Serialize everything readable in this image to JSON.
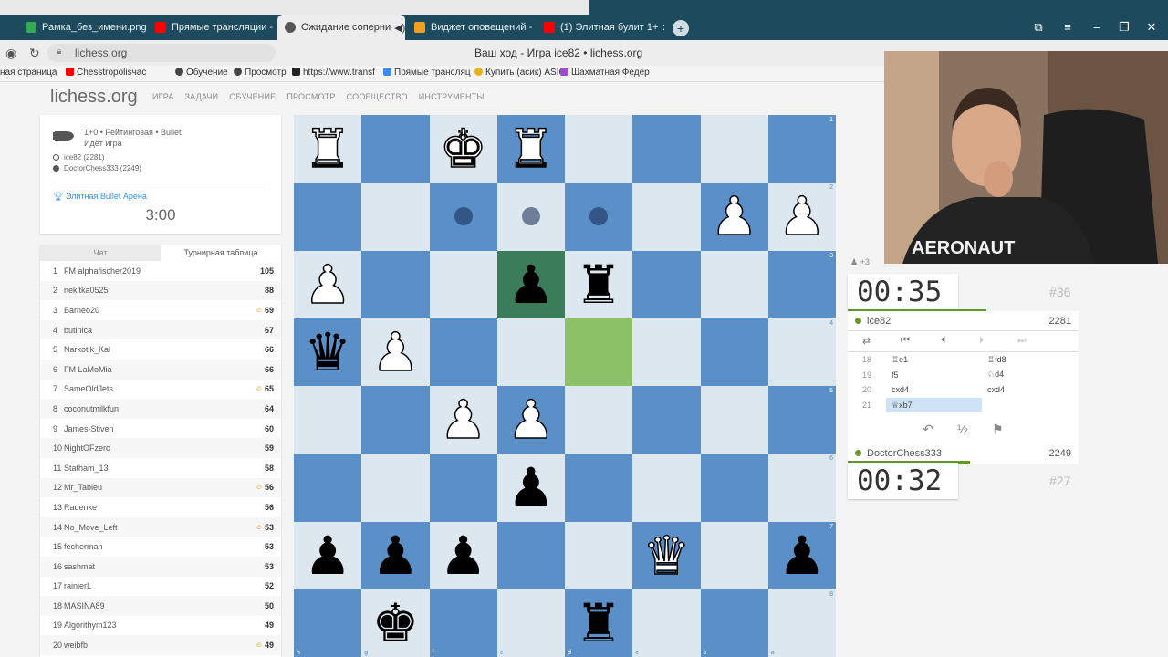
{
  "browser": {
    "tabs": [
      {
        "label": "Рамка_без_имени.png - G",
        "icon_color": "#34a853"
      },
      {
        "label": "Прямые трансляции - You",
        "icon_color": "#ff0000"
      },
      {
        "label": "Ожидание соперни",
        "icon_color": "#555555",
        "active": true
      },
      {
        "label": "Виджет оповещений - Па",
        "icon_color": "#f0a020"
      },
      {
        "label": "(1) Элитная булит 1+",
        "icon_color": "#ff0000"
      }
    ],
    "url": "lichess.org",
    "page_title": "Ваш ход - Игра ice82 • lichess.org",
    "bookmarks": [
      {
        "label": "ная страница",
        "icon_color": "#cccccc"
      },
      {
        "label": "Chesstropolisчас",
        "icon_color": "#ff0000"
      },
      {
        "label": "Обучение",
        "icon_color": "#444444"
      },
      {
        "label": "Просмотр",
        "icon_color": "#444444"
      },
      {
        "label": "https://www.transf",
        "icon_color": "#222222"
      },
      {
        "label": "Прямые трансляц",
        "icon_color": "#4285f4"
      },
      {
        "label": "Купить (асик) ASIC",
        "icon_color": "#e8b020"
      },
      {
        "label": "Шахматная Федер",
        "icon_color": "#9b4dca"
      }
    ]
  },
  "site": {
    "logo": "lichess.org",
    "nav": [
      "ИГРА",
      "ЗАДАЧИ",
      "ОБУЧЕНИЕ",
      "ПРОСМОТР",
      "СООБЩЕСТВО",
      "ИНСТРУМЕНТЫ"
    ]
  },
  "game_info": {
    "mode": "1+0 • Рейтинговая • Bullet",
    "status": "Идёт игра",
    "white": "ice82 (2281)",
    "black": "DoctorChess333 (2249)",
    "arena": "Элитная Bullet Арена",
    "clock": "3:00"
  },
  "standings_tabs": {
    "chat": "Чат",
    "table": "Турнирная таблица"
  },
  "standings": [
    {
      "rank": "1",
      "name": "FM alphafischer2019",
      "score": "105",
      "fire": false
    },
    {
      "rank": "2",
      "name": "nekitka0525",
      "score": "88",
      "fire": false
    },
    {
      "rank": "3",
      "name": "Barneo20",
      "score": "69",
      "fire": true
    },
    {
      "rank": "4",
      "name": "butinica",
      "score": "67",
      "fire": false
    },
    {
      "rank": "5",
      "name": "Narkotik_Kal",
      "score": "66",
      "fire": false
    },
    {
      "rank": "6",
      "name": "FM LaMoMia",
      "score": "66",
      "fire": false
    },
    {
      "rank": "7",
      "name": "SameOldJets",
      "score": "65",
      "fire": true
    },
    {
      "rank": "8",
      "name": "coconutmilkfun",
      "score": "64",
      "fire": false
    },
    {
      "rank": "9",
      "name": "James-Stiven",
      "score": "60",
      "fire": false
    },
    {
      "rank": "10",
      "name": "NightOFzero",
      "score": "59",
      "fire": false
    },
    {
      "rank": "11",
      "name": "Statham_13",
      "score": "58",
      "fire": false
    },
    {
      "rank": "12",
      "name": "Mr_Tableu",
      "score": "56",
      "fire": true
    },
    {
      "rank": "13",
      "name": "Radenke",
      "score": "56",
      "fire": false
    },
    {
      "rank": "14",
      "name": "No_Move_Left",
      "score": "53",
      "fire": true
    },
    {
      "rank": "15",
      "name": "fecherman",
      "score": "53",
      "fire": false
    },
    {
      "rank": "16",
      "name": "sashmat",
      "score": "53",
      "fire": false
    },
    {
      "rank": "17",
      "name": "rainierL",
      "score": "52",
      "fire": false
    },
    {
      "rank": "18",
      "name": "MASINA89",
      "score": "50",
      "fire": false
    },
    {
      "rank": "19",
      "name": "Algorithym123",
      "score": "49",
      "fire": false
    },
    {
      "rank": "20",
      "name": "weibfb",
      "score": "49",
      "fire": true
    }
  ],
  "board": {
    "orientation": "black",
    "rows": [
      "wR . wK wR . . . .",
      ". . * * * . wP wP",
      "wP . . bP bR . . .",
      "bQ wP . . . . . .",
      ". . wP wP . . . .",
      ". . . bP . . . .",
      "bP bP bP . . wQ . bP",
      ". bK . . bR . . ."
    ],
    "last_move_from": [
      2,
      3
    ],
    "last_move_to": [
      3,
      4
    ],
    "ranks": [
      "1",
      "2",
      "3",
      "4",
      "5",
      "6",
      "7",
      "8"
    ],
    "files": [
      "h",
      "g",
      "f",
      "e",
      "d",
      "c",
      "b",
      "a"
    ]
  },
  "right_panel": {
    "extra": "+3",
    "top_clock": {
      "time": "00:35",
      "movenum": "#36"
    },
    "top_player": {
      "name": "ice82",
      "rating": "2281",
      "progress": 0.6
    },
    "moves": [
      {
        "num": "18",
        "white": "♖e1",
        "black": "♖fd8"
      },
      {
        "num": "19",
        "white": "f5",
        "black": "♘d4"
      },
      {
        "num": "20",
        "white": "cxd4",
        "black": "cxd4"
      },
      {
        "num": "21",
        "white": "♕xb7",
        "black": "",
        "current": true
      }
    ],
    "actions": {
      "back": "↶",
      "draw": "½",
      "resign": "⚑"
    },
    "bottom_player": {
      "name": "DoctorChess333",
      "rating": "2249",
      "progress": 0.53
    },
    "bottom_clock": {
      "time": "00:32",
      "movenum": "#27"
    },
    "webcam_text": "AERONAUT"
  }
}
